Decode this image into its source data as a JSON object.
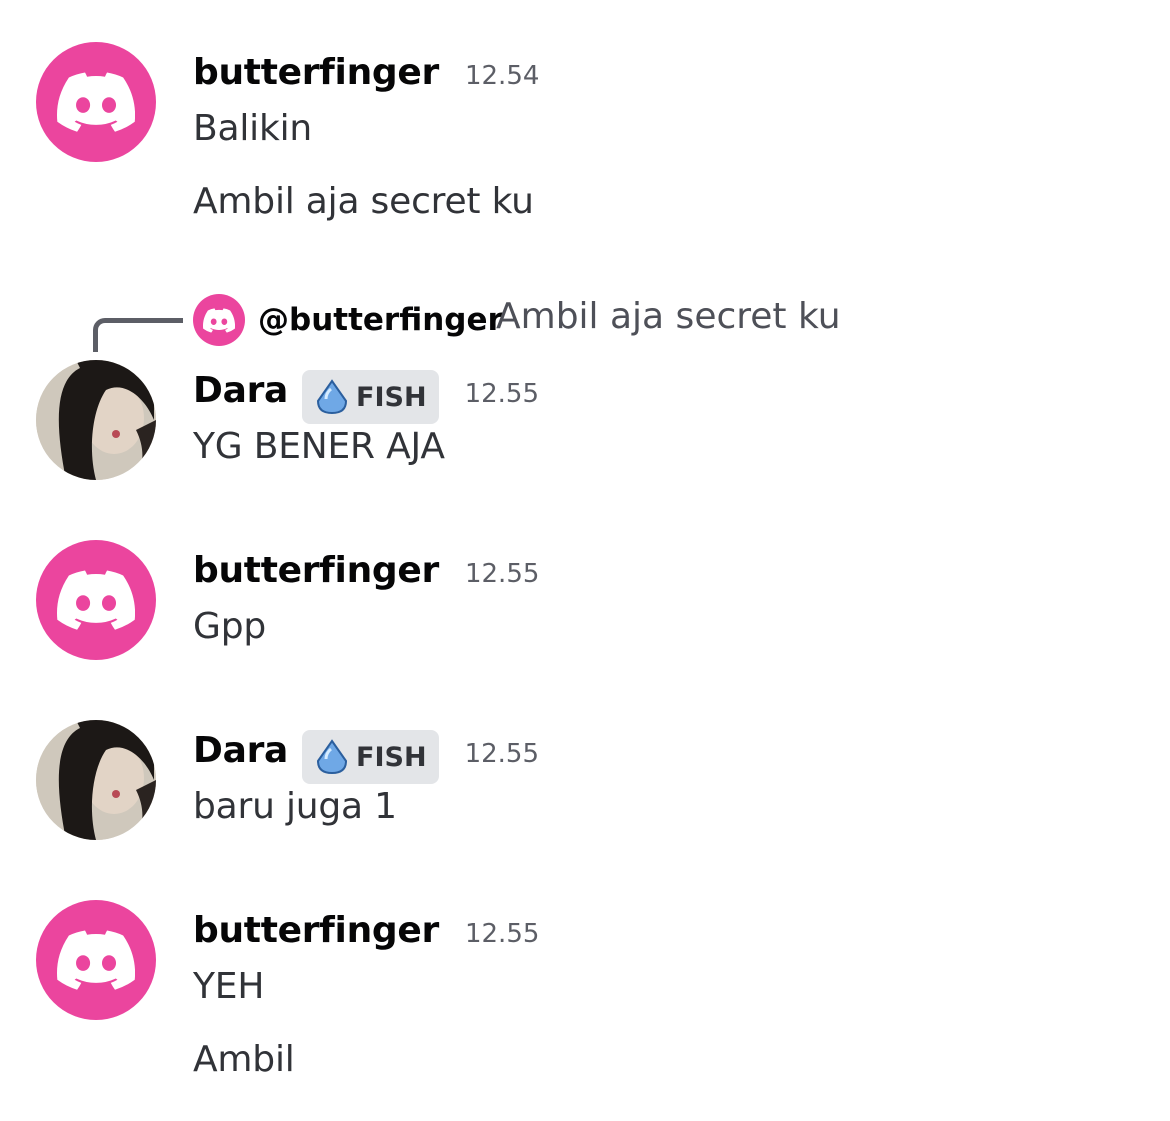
{
  "colors": {
    "discord_pink": "#eb459e",
    "tag_bg": "#e3e5e8",
    "name": "#060607",
    "timestamp": "#5c5e66"
  },
  "messages": [
    {
      "author": "butterfinger",
      "time": "12.54",
      "avatar": "discord-logo-icon",
      "lines": [
        "Balikin",
        "Ambil aja secret ku"
      ]
    },
    {
      "author": "Dara",
      "tag": "FISH",
      "time": "12.55",
      "avatar": "profile-photo",
      "lines": [
        "YG BENER AJA"
      ]
    },
    {
      "author": "butterfinger",
      "time": "12.55",
      "avatar": "discord-logo-icon",
      "lines": [
        "Gpp"
      ]
    },
    {
      "author": "Dara",
      "tag": "FISH",
      "time": "12.55",
      "avatar": "profile-photo",
      "lines": [
        "baru juga 1"
      ]
    },
    {
      "author": "butterfinger",
      "time": "12.55",
      "avatar": "discord-logo-icon",
      "lines": [
        "YEH",
        "Ambil"
      ]
    }
  ],
  "reply": {
    "mention": "@butterfinger",
    "text": "Ambil aja secret ku"
  }
}
